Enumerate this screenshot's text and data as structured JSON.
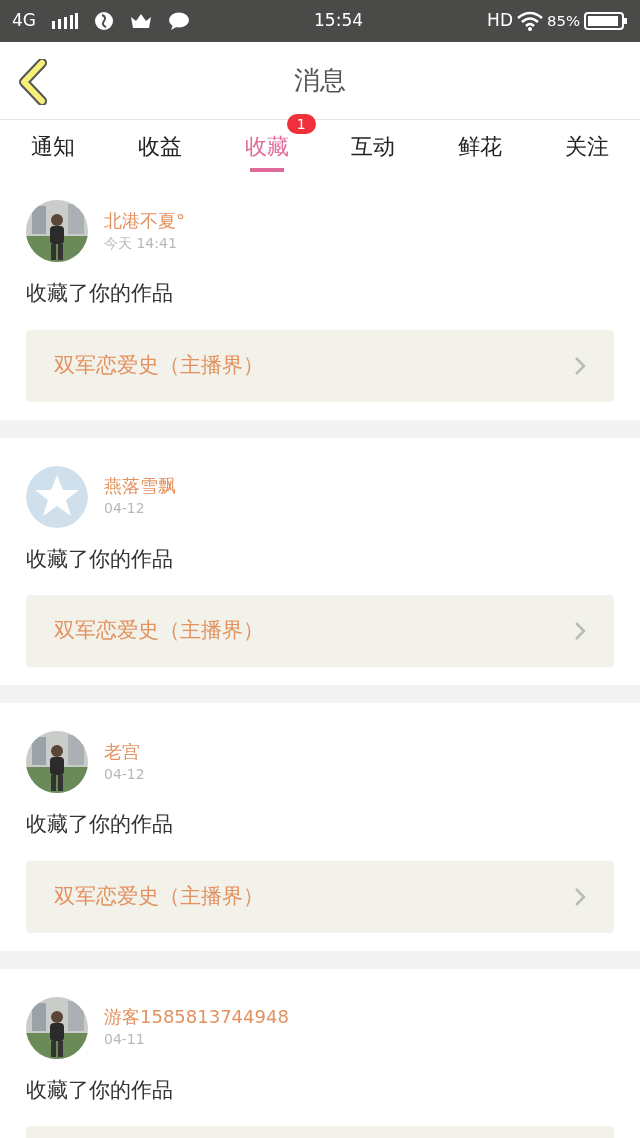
{
  "status_bar": {
    "network": "4G",
    "time": "15:54",
    "hd": "HD",
    "battery": "85%"
  },
  "header": {
    "title": "消息"
  },
  "tabs": [
    {
      "label": "通知",
      "selected": false
    },
    {
      "label": "收益",
      "selected": false
    },
    {
      "label": "收藏",
      "selected": true,
      "badge": "1"
    },
    {
      "label": "互动",
      "selected": false
    },
    {
      "label": "鲜花",
      "selected": false
    },
    {
      "label": "关注",
      "selected": false
    }
  ],
  "messages": [
    {
      "name": "北港不夏°",
      "time": "今天 14:41",
      "text": "收藏了你的作品",
      "work": {
        "title": "双军恋爱史（主播界）"
      }
    },
    {
      "avatar": {
        "kind": "icon"
      },
      "name": "燕落雪飘",
      "time": "04-12",
      "text": "收藏了你的作品",
      "work": {
        "title": "双军恋爱史（主播界）"
      }
    },
    {
      "name": "老宫",
      "time": "04-12",
      "text": "收藏了你的作品",
      "work": {
        "title": "双军恋爱史（主播界）"
      }
    },
    {
      "name": "游客1585813744948",
      "time": "04-11",
      "text": "收藏了你的作品",
      "work": {
        "kind": "cut"
      }
    }
  ]
}
